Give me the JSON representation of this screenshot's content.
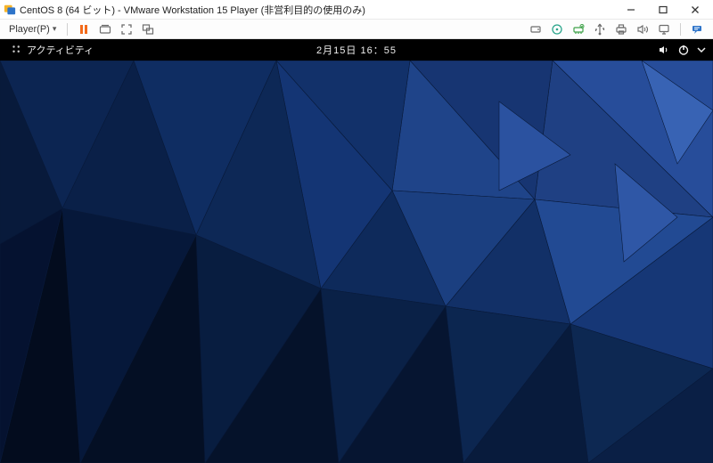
{
  "window": {
    "title": "CentOS 8 (64 ビット) - VMware Workstation 15 Player (非営利目的の使用のみ)"
  },
  "vm_toolbar": {
    "player_menu_label": "Player(P)"
  },
  "gnome": {
    "activities_label": "アクティビティ",
    "clock_text": "2月15日  16：55"
  },
  "colors": {
    "pause_orange": "#f26a1b",
    "icon_gray": "#6d6d6d",
    "icon_teal": "#2aa58b",
    "icon_green": "#3fa24a",
    "icon_blue": "#2e74c9",
    "gnome_fg": "#eeeeee"
  }
}
